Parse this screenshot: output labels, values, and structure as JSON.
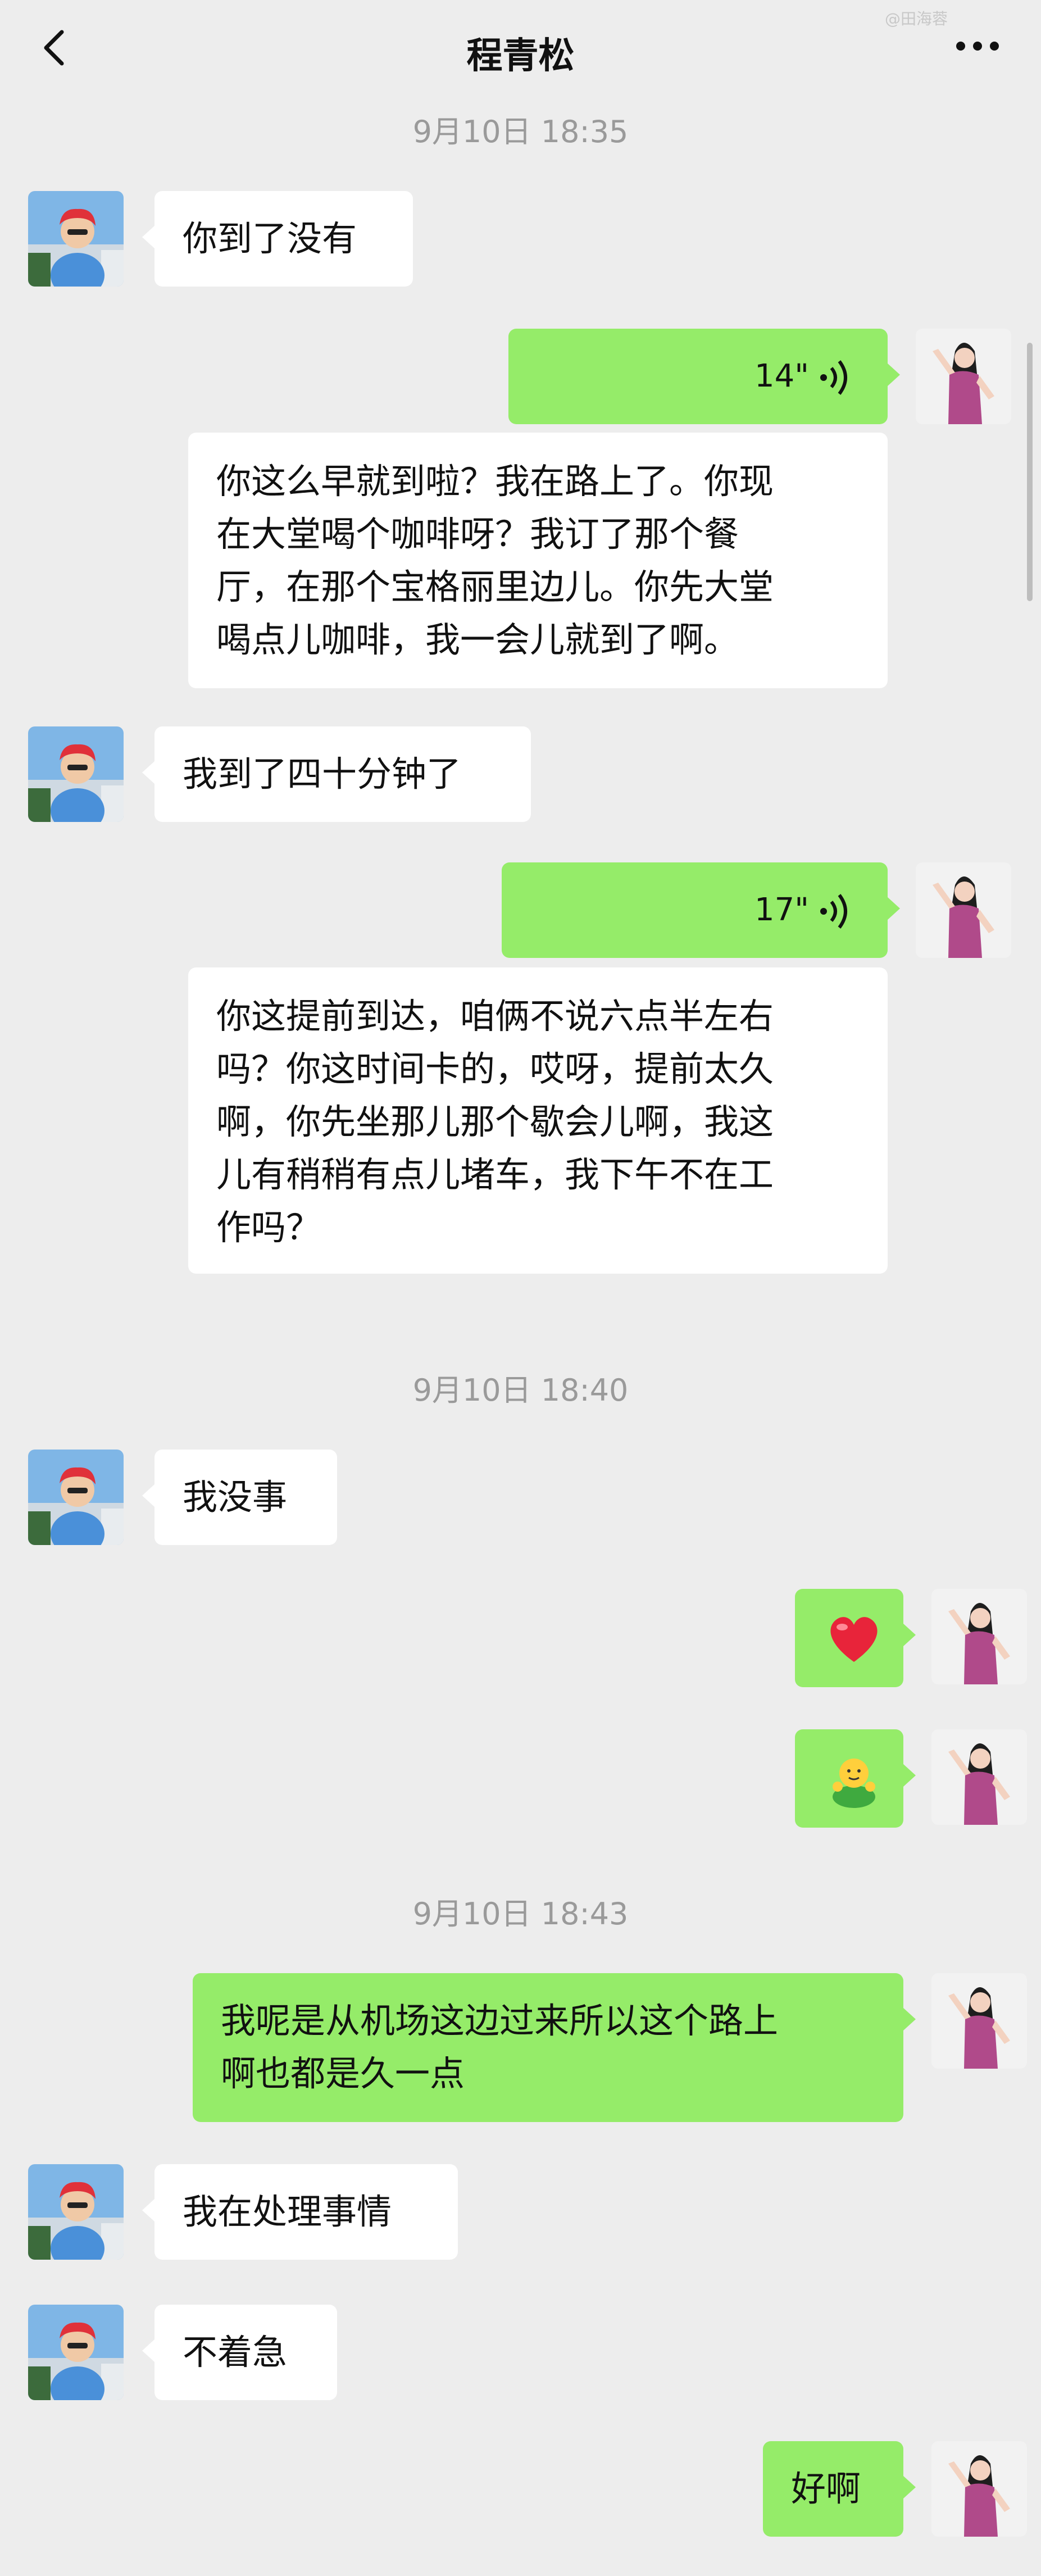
{
  "header": {
    "title": "程青松",
    "watermark": "@田海蓉",
    "back_icon": "chevron-left-icon",
    "more_icon": "more-dots-icon"
  },
  "colors": {
    "background": "#ededed",
    "incoming_bubble": "#ffffff",
    "outgoing_bubble": "#95ec69"
  },
  "timestamps": [
    "9月10日 18:35",
    "9月10日 18:40",
    "9月10日 18:43"
  ],
  "messages": [
    {
      "sender": "contact",
      "type": "text",
      "text": "你到了没有"
    },
    {
      "sender": "me",
      "type": "voice",
      "duration": "14\"",
      "transcript": [
        "你这么早就到啦？我在路上了。你现",
        "在大堂喝个咖啡呀？我订了那个餐",
        "厅，在那个宝格丽里边儿。你先大堂",
        "喝点儿咖啡，我一会儿就到了啊。"
      ]
    },
    {
      "sender": "contact",
      "type": "text",
      "text": "我到了四十分钟了"
    },
    {
      "sender": "me",
      "type": "voice",
      "duration": "17\"",
      "transcript": [
        "你这提前到达，咱俩不说六点半左右",
        "吗？你这时间卡的，哎呀，提前太久",
        "啊，你先坐那儿那个歇会儿啊，我这",
        "儿有稍稍有点儿堵车，我下午不在工",
        "作吗？"
      ]
    },
    {
      "sender": "contact",
      "type": "text",
      "text": "我没事"
    },
    {
      "sender": "me",
      "type": "emoji",
      "emoji": "red-heart-icon"
    },
    {
      "sender": "me",
      "type": "emoji",
      "emoji": "green-person-emoji-icon"
    },
    {
      "sender": "me",
      "type": "text",
      "lines": [
        "我呢是从机场这边过来所以这个路上",
        "啊也都是久一点"
      ]
    },
    {
      "sender": "contact",
      "type": "text",
      "text": "我在处理事情"
    },
    {
      "sender": "contact",
      "type": "text",
      "text": "不着急"
    },
    {
      "sender": "me",
      "type": "text",
      "text": "好啊"
    }
  ]
}
